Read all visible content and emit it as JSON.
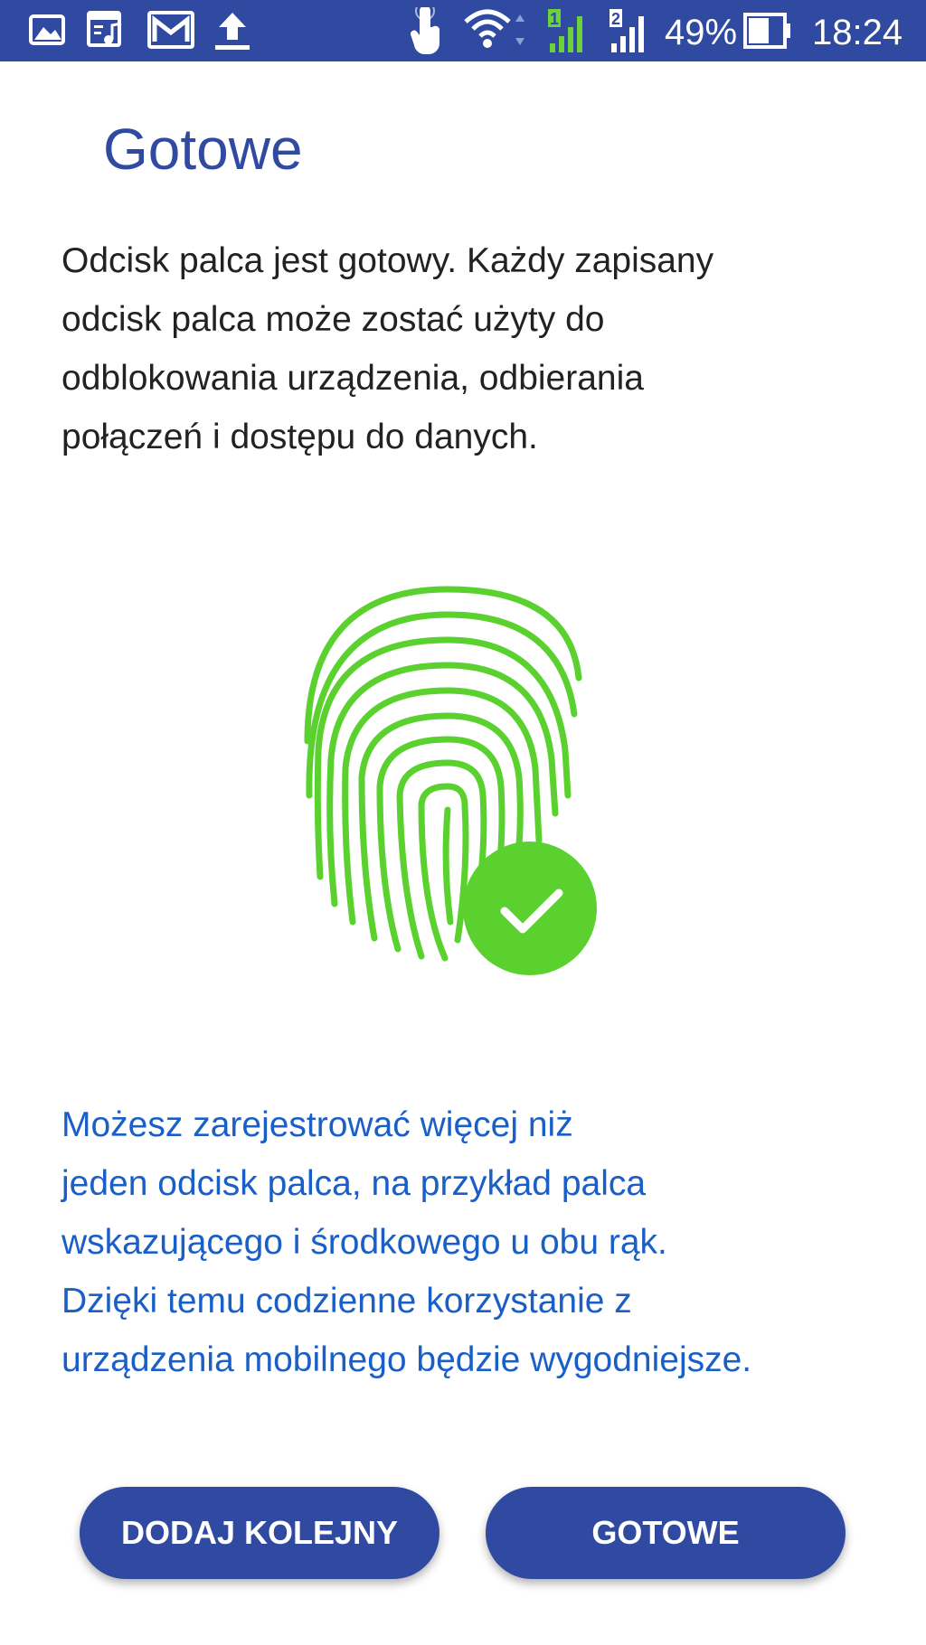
{
  "status_bar": {
    "battery_percent": "49%",
    "time": "18:24",
    "sim1_label": "1",
    "sim2_label": "2",
    "icons": [
      "image-icon",
      "music-playlist-icon",
      "gmail-icon",
      "upload-icon",
      "touch-icon",
      "wifi-icon",
      "signal-sim1-icon",
      "signal-sim2-icon",
      "battery-icon"
    ],
    "colors": {
      "background": "#2f4aa0",
      "sim1_signal": "#6dd23a"
    }
  },
  "page": {
    "title": "Gotowe",
    "intro_lines": [
      "Odcisk palca jest gotowy. Każdy zapisany",
      "odcisk palca może zostać użyty do",
      "odblokowania urządzenia, odbierania",
      "połączeń i dostępu do danych."
    ],
    "info_lines": [
      "Możesz zarejestrować więcej niż",
      "jeden odcisk palca, na przykład palca",
      "wskazującego i środkowego u obu rąk.",
      "Dzięki temu codzienne korzystanie z",
      "urządzenia mobilnego będzie wygodniejsze."
    ],
    "illustration": {
      "icon": "fingerprint-icon",
      "badge_icon": "check-icon",
      "color": "#5ad12e"
    }
  },
  "buttons": {
    "add_another": "DODAJ KOLEJNY",
    "done": "GOTOWE"
  },
  "colors": {
    "accent": "#2f4aa0",
    "info_text": "#1a5fc8"
  }
}
